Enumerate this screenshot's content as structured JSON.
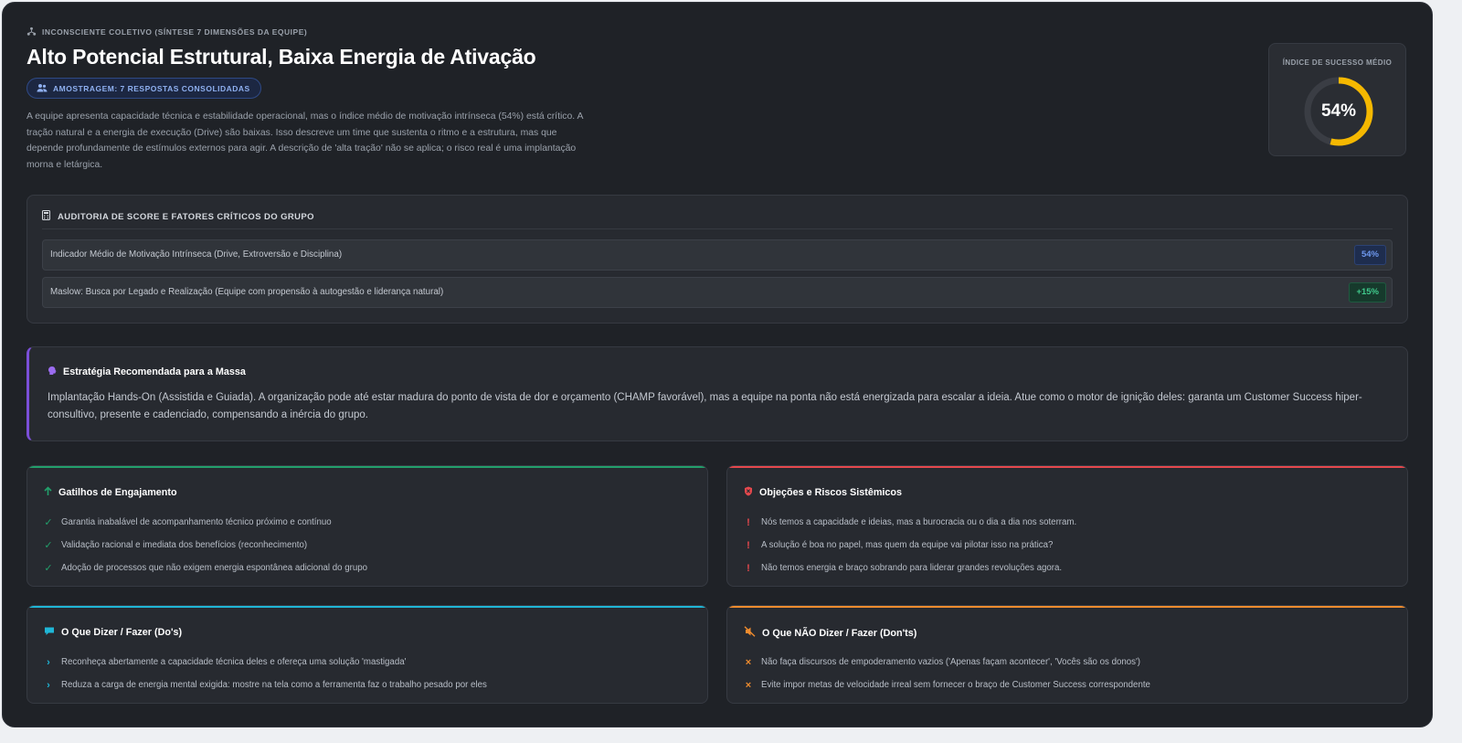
{
  "header": {
    "eyebrow": "INCONSCIENTE COLETIVO (SÍNTESE 7 DIMENSÕES DA EQUIPE)",
    "title": "Alto Potencial Estrutural, Baixa Energia de Ativação",
    "sample_badge": "AMOSTRAGEM: 7 RESPOSTAS CONSOLIDADAS",
    "description": "A equipe apresenta capacidade técnica e estabilidade operacional, mas o índice médio de motivação intrínseca (54%) está crítico. A tração natural e a energia de execução (Drive) são baixas. Isso descreve um time que sustenta o ritmo e a estrutura, mas que depende profundamente de estímulos externos para agir. A descrição de 'alta tração' não se aplica; o risco real é uma implantação morna e letárgica."
  },
  "score": {
    "label": "ÍNDICE DE SUCESSO MÉDIO",
    "value_text": "54%",
    "value": 54,
    "ring_color": "#f5b800",
    "track_color": "#3a3d44"
  },
  "audit": {
    "title": "AUDITORIA DE SCORE E FATORES CRÍTICOS DO GRUPO",
    "rows": [
      {
        "label": "Indicador Médio de Motivação Intrínseca (Drive, Extroversão e Disciplina)",
        "badge": "54%"
      },
      {
        "label": "Maslow: Busca por Legado e Realização (Equipe com propensão à autogestão e liderança natural)",
        "badge": "+15%"
      }
    ]
  },
  "strategy": {
    "title": "Estratégia Recomendada para a Massa",
    "body": "Implantação Hands-On (Assistida e Guiada). A organização pode até estar madura do ponto de vista de dor e orçamento (CHAMP favorável), mas a equipe na ponta não está energizada para escalar a ideia. Atue como o motor de ignição deles: garanta um Customer Success hiper-consultivo, presente e cadenciado, compensando a inércia do grupo."
  },
  "triggers": {
    "title": "Gatilhos de Engajamento",
    "accent": "#22a06b",
    "items": [
      "Garantia inabalável de acompanhamento técnico próximo e contínuo",
      "Validação racional e imediata dos benefícios (reconhecimento)",
      "Adoção de processos que não exigem energia espontânea adicional do grupo"
    ]
  },
  "objections": {
    "title": "Objeções e Riscos Sistêmicos",
    "accent": "#e5484d",
    "items": [
      "Nós temos a capacidade e ideias, mas a burocracia ou o dia a dia nos soterram.",
      "A solução é boa no papel, mas quem da equipe vai pilotar isso na prática?",
      "Não temos energia e braço sobrando para liderar grandes revoluções agora."
    ]
  },
  "dos": {
    "title": "O Que Dizer / Fazer (Do's)",
    "accent": "#1fb6d6",
    "items": [
      "Reconheça abertamente a capacidade técnica deles e ofereça uma solução 'mastigada'",
      "Reduza a carga de energia mental exigida: mostre na tela como a ferramenta faz o trabalho pesado por eles"
    ]
  },
  "donts": {
    "title": "O Que NÃO Dizer / Fazer (Don'ts)",
    "accent": "#f08c2e",
    "items": [
      "Não faça discursos de empoderamento vazios ('Apenas façam acontecer', 'Vocês são os donos')",
      "Evite impor metas de velocidade irreal sem fornecer o braço de Customer Success correspondente"
    ]
  },
  "icons": {
    "eyebrow": "network-icon",
    "sample": "users-icon",
    "audit": "calculator-icon",
    "strategy": "brain-icon",
    "triggers": "arrow-up-icon",
    "objections": "shield-icon",
    "dos": "chat-bubble-icon",
    "donts": "mute-icon"
  }
}
